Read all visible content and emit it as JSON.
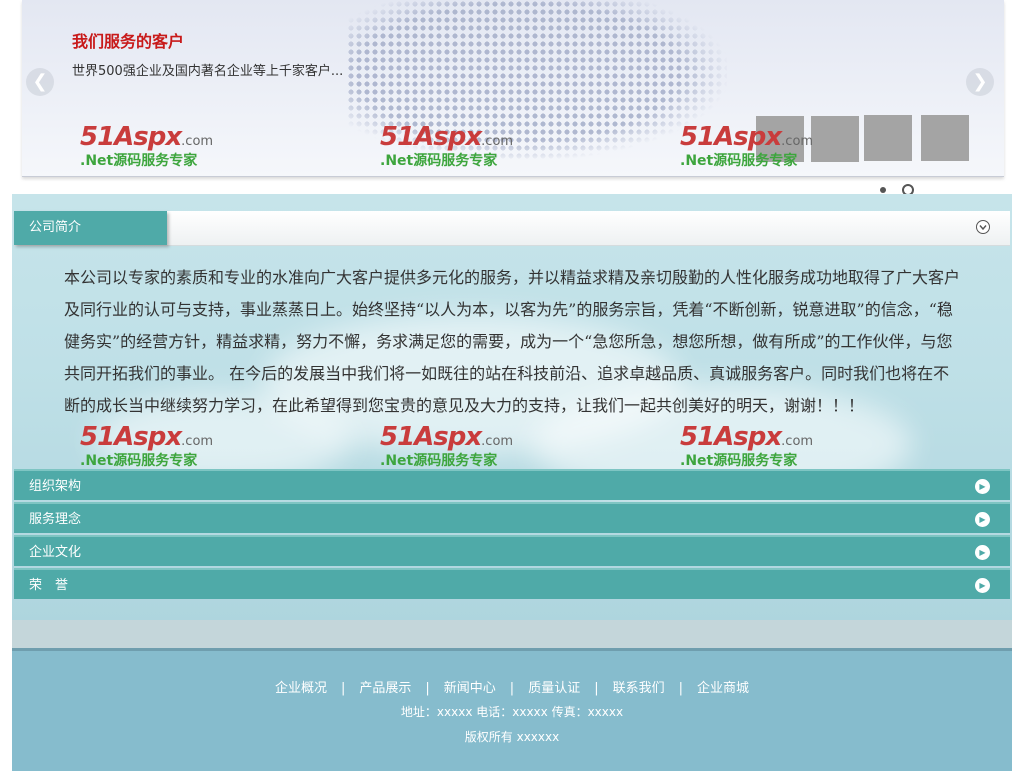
{
  "banner": {
    "title": "我们服务的客户",
    "subtitle": "世界500强企业及国内著名企业等上千家客户...",
    "prev_arrow": "❮",
    "next_arrow": "❯"
  },
  "watermark": {
    "logo_main": "51Aspx",
    "logo_suffix": ".com",
    "slogan": ".Net源码服务专家"
  },
  "intro_panel": {
    "tab_label": "公司简介",
    "text": "本公司以专家的素质和专业的水准向广大客户提供多元化的服务，并以精益求精及亲切殷勤的人性化服务成功地取得了广大客户及同行业的认可与支持，事业蒸蒸日上。始终坚持“以人为本，以客为先”的服务宗旨，凭着“不断创新，锐意进取”的信念，“稳健务实”的经营方针，精益求精，努力不懈，务求满足您的需要，成为一个“急您所急，想您所想，做有所成”的工作伙伴，与您共同开拓我们的事业。 在今后的发展当中我们将一如既往的站在科技前沿、追求卓越品质、真诚服务客户。同时我们也将在不断的成长当中继续努力学习，在此希望得到您宝贵的意见及大力的支持，让我们一起共创美好的明天，谢谢！！！"
  },
  "accordion": [
    {
      "label": "组织架构"
    },
    {
      "label": "服务理念"
    },
    {
      "label": "企业文化"
    },
    {
      "label": "荣　誉"
    }
  ],
  "footer": {
    "links": [
      "企业概况",
      "产品展示",
      "新闻中心",
      "质量认证",
      "联系我们",
      "企业商城"
    ],
    "separator": "|",
    "contact": "地址：xxxxx 电话：xxxxx 传真：xxxxx",
    "copyright": "版权所有 xxxxxx"
  },
  "colors": {
    "accent_teal": "#4faaa8",
    "footer_blue": "#86bccd",
    "banner_title_red": "#c81a1a",
    "watermark_red": "#c93c3c",
    "watermark_green": "#3da53d"
  },
  "icons": {
    "panel_toggle": "chevron-down-circle-icon",
    "accordion_item": "play-circle-icon",
    "nav": "arrow-circle-icon"
  }
}
